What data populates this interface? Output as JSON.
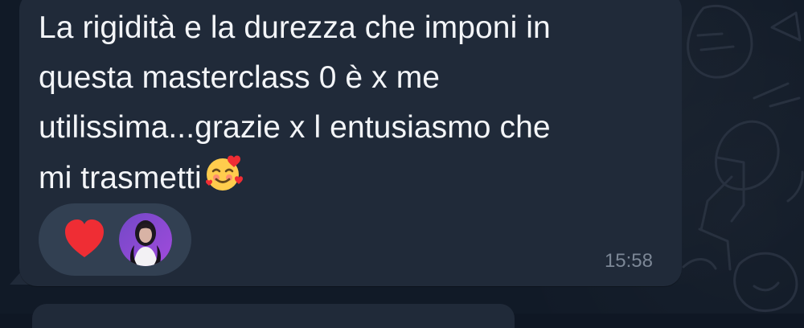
{
  "message": {
    "text": "La rigidità e la durezza che imponi in\nquesta masterclass 0 è x me\nutilissima...grazie x l entusiasmo che\nmi trasmetti",
    "time": "15:58",
    "trailing_emoji": "smiling-face-with-hearts"
  },
  "reaction": {
    "emoji": "heart",
    "avatar": "user-avatar"
  },
  "colors": {
    "bubble": "#202a39",
    "background": "#111a27",
    "text": "#f3f5f8",
    "time": "#7c8796",
    "reaction_pill": "#324052",
    "heart": "#ef2d34"
  }
}
